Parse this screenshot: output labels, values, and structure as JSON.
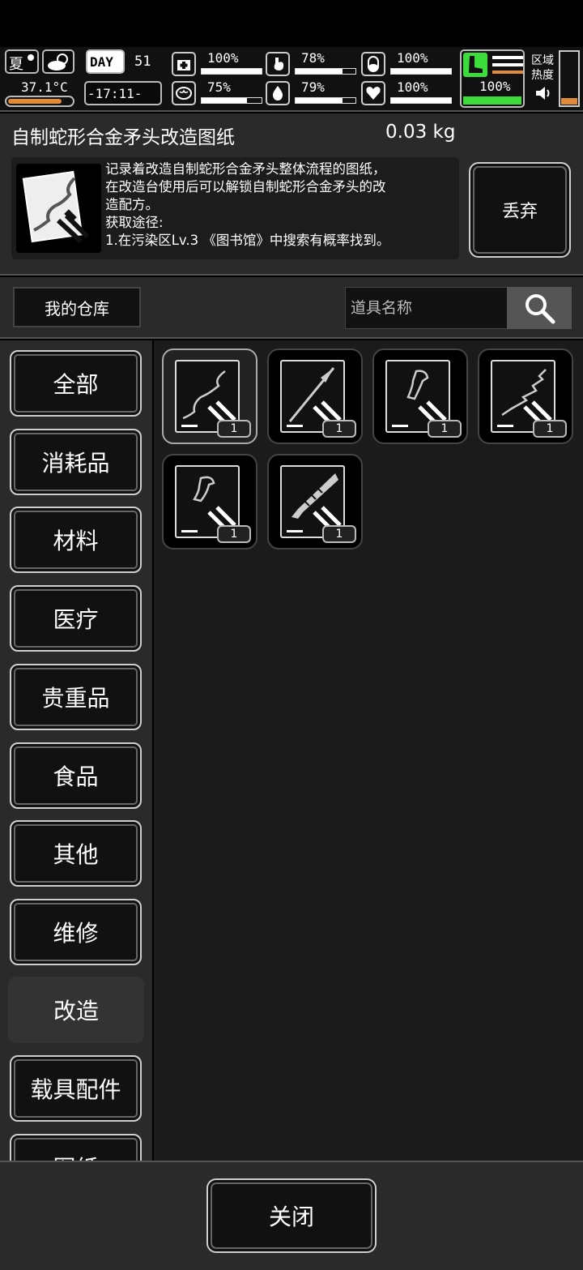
{
  "status": {
    "season": "夏",
    "temperature": "37.1°C",
    "day_label": "DAY",
    "day_number": "51",
    "time": "-17:11-",
    "region_heat_label": "区域\n热度",
    "stats": [
      {
        "icon": "first-aid-icon",
        "value": "100%",
        "level": 1.0
      },
      {
        "icon": "stomach-icon",
        "value": "78%",
        "level": 0.78
      },
      {
        "icon": "pill-icon",
        "value": "100%",
        "level": 1.0
      },
      {
        "icon": "brain-icon",
        "value": "75%",
        "level": 0.75
      },
      {
        "icon": "water-drop-icon",
        "value": "79%",
        "level": 0.79
      },
      {
        "icon": "heart-icon",
        "value": "100%",
        "level": 1.0
      }
    ],
    "stamina": {
      "icon": "boot-icon",
      "value": "100%",
      "level": 1.0,
      "color": "#3ddc3d"
    }
  },
  "detail": {
    "name": "自制蛇形合金矛头改造图纸",
    "weight": "0.03 kg",
    "description": "记录着改造自制蛇形合金矛头整体流程的图纸，\n在改造台使用后可以解锁自制蛇形合金矛头的改\n造配方。\n获取途径:\n1.在污染区Lv.3 《图书馆》中搜索有概率找到。",
    "discard_label": "丢弃"
  },
  "warehouse": {
    "tab_label": "我的仓库",
    "search_placeholder": "道具名称"
  },
  "categories": [
    "全部",
    "消耗品",
    "材料",
    "医疗",
    "贵重品",
    "食品",
    "其他",
    "维修",
    "改造",
    "载具配件",
    "图纸"
  ],
  "active_category": "改造",
  "items": [
    {
      "name": "serpent-spearhead-blueprint",
      "count": "1",
      "selected": true
    },
    {
      "name": "spear-blueprint",
      "count": "1",
      "selected": false
    },
    {
      "name": "trigger-blueprint-a",
      "count": "1",
      "selected": false
    },
    {
      "name": "jagged-blade-blueprint",
      "count": "1",
      "selected": false
    },
    {
      "name": "trigger-blueprint-b",
      "count": "1",
      "selected": false
    },
    {
      "name": "saw-blade-blueprint",
      "count": "1",
      "selected": false
    }
  ],
  "footer": {
    "close_label": "关闭"
  }
}
